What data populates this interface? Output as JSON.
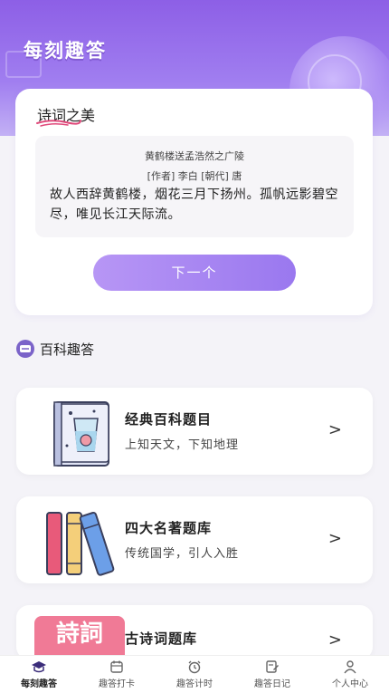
{
  "app": {
    "title": "每刻趣答"
  },
  "poem": {
    "section_title": "诗词之美",
    "name": "黄鹤楼送孟浩然之广陵",
    "author_line": "[作者] 李白 [朝代] 唐",
    "text": "故人西辞黄鹤楼，烟花三月下扬州。孤帆远影碧空尽，唯见长江天际流。",
    "next_label": "下一个"
  },
  "encyclopedia": {
    "section_title": "百科趣答",
    "cards": [
      {
        "title": "经典百科题目",
        "subtitle": "上知天文，下知地理",
        "icon": "water-glass-book-icon",
        "chevron": ">"
      },
      {
        "title": "四大名著题库",
        "subtitle": "传统国学，引人入胜",
        "icon": "books-icon",
        "chevron": ">"
      },
      {
        "title": "古诗词题库",
        "subtitle": "",
        "icon": "poetry-calligraphy-icon",
        "chevron": ">",
        "thumb_text": "詩詞"
      }
    ]
  },
  "tabbar": {
    "tabs": [
      {
        "label": "每刻趣答",
        "icon": "graduation-cap-icon",
        "active": true
      },
      {
        "label": "趣答打卡",
        "icon": "calendar-icon",
        "active": false
      },
      {
        "label": "趣答计时",
        "icon": "alarm-clock-icon",
        "active": false
      },
      {
        "label": "趣答日记",
        "icon": "edit-note-icon",
        "active": false
      },
      {
        "label": "个人中心",
        "icon": "person-icon",
        "active": false
      }
    ]
  },
  "colors": {
    "accent": "#9a78ef",
    "hero_top": "#8d5fe6",
    "underline": "#e0487a"
  }
}
